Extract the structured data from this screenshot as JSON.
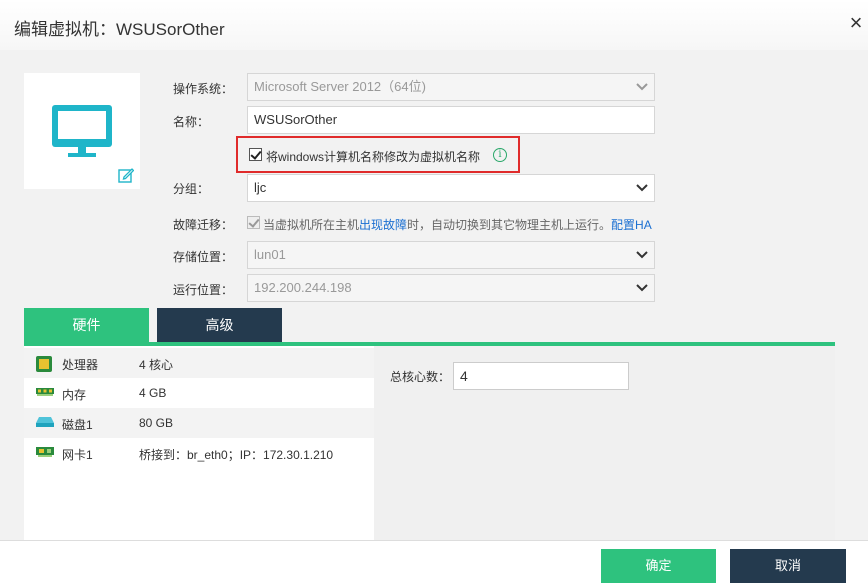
{
  "dialog": {
    "title": "编辑虚拟机：WSUSorOther"
  },
  "form": {
    "os": {
      "label": "操作系统：",
      "value": "Microsoft Server 2012（64位)"
    },
    "name": {
      "label": "名称：",
      "value": "WSUSorOther"
    },
    "rename_checkbox": {
      "label": "将windows计算机名称修改为虚拟机名称",
      "checked": true
    },
    "group": {
      "label": "分组：",
      "value": "ljc"
    },
    "failover": {
      "label": "故障迁移：",
      "text_before": "当虚拟机所在主机",
      "link1": "出现故障",
      "text_after": "时，自动切换到其它物理主机上运行。",
      "link2": "配置HA",
      "checked": true
    },
    "storage": {
      "label": "存储位置：",
      "value": "lun01"
    },
    "run_location": {
      "label": "运行位置：",
      "value": "192.200.244.198"
    }
  },
  "tabs": [
    {
      "label": "硬件",
      "active": true
    },
    {
      "label": "高级",
      "active": false
    }
  ],
  "hardware": [
    {
      "icon": "cpu-icon",
      "name": "处理器",
      "value": "4 核心"
    },
    {
      "icon": "memory-icon",
      "name": "内存",
      "value": "4 GB"
    },
    {
      "icon": "disk-icon",
      "name": "磁盘1",
      "value": "80 GB"
    },
    {
      "icon": "nic-icon",
      "name": "网卡1",
      "value": "桥接到：br_eth0；IP：172.30.1.210"
    }
  ],
  "cpu_detail": {
    "label": "总核心数：",
    "value": "4"
  },
  "footer": {
    "ok": "确定",
    "cancel": "取消"
  },
  "colors": {
    "accent": "#2ec27e",
    "dark": "#243a4e",
    "link": "#1a6fd1",
    "highlight_border": "#e02b2b"
  }
}
